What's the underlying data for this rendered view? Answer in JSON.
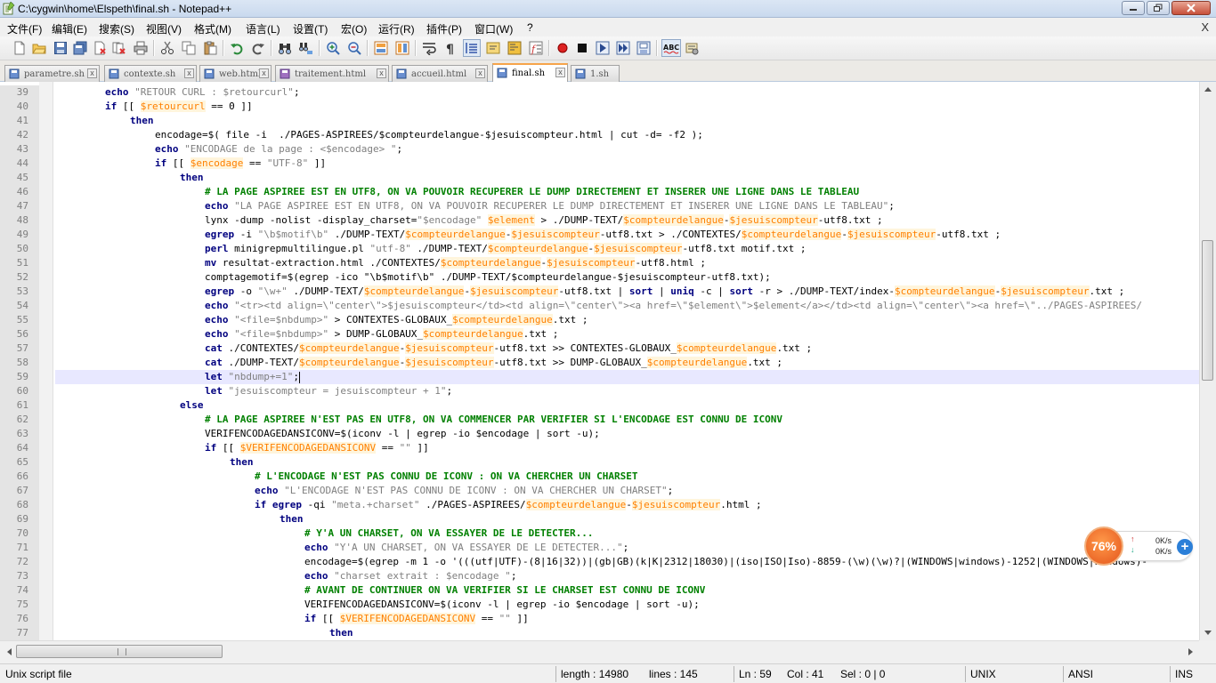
{
  "window": {
    "title": "C:\\cygwin\\home\\Elspeth\\final.sh - Notepad++"
  },
  "menu": {
    "items": [
      "文件(F)",
      "编辑(E)",
      "搜索(S)",
      "视图(V)",
      "格式(M)",
      "语言(L)",
      "设置(T)",
      "宏(O)",
      "运行(R)",
      "插件(P)",
      "窗口(W)",
      "?"
    ],
    "close_glyph": "X"
  },
  "toolbar": {
    "icons": [
      "new-file-icon",
      "open-file-icon",
      "save-icon",
      "save-all-icon",
      "close-icon",
      "close-all-icon",
      "print-icon",
      "cut-icon",
      "copy-icon",
      "paste-icon",
      "undo-icon",
      "redo-icon",
      "find-icon",
      "replace-icon",
      "zoom-in-icon",
      "zoom-out-icon",
      "sync-vertical-icon",
      "sync-horizontal-icon",
      "word-wrap-icon",
      "show-all-characters-icon",
      "indent-guide-icon",
      "user-language-icon",
      "doc-map-icon",
      "function-list-icon",
      "record-macro-icon",
      "stop-record-icon",
      "play-macro-icon",
      "run-macro-multiple-icon",
      "save-macro-icon",
      "spell-check-icon",
      "spell-check-options-icon"
    ],
    "spellcheck_label": "ABC"
  },
  "tabs": [
    {
      "label": "parametre.sh",
      "active": false
    },
    {
      "label": "contexte.sh",
      "active": false
    },
    {
      "label": "web.html",
      "active": false
    },
    {
      "label": "traitement.html",
      "active": false
    },
    {
      "label": "accueil.html",
      "active": false
    },
    {
      "label": "final.sh",
      "active": true
    },
    {
      "label": "1.sh",
      "active": false
    }
  ],
  "tab_close_glyph": "x",
  "editor": {
    "current_line": 59,
    "lines": [
      {
        "n": 39,
        "indent": 14,
        "tokens": [
          [
            "kw",
            "echo"
          ],
          [
            "st",
            " \"RETOUR CURL : $retourcurl\""
          ],
          [
            "",
            "; "
          ]
        ]
      },
      {
        "n": 40,
        "indent": 14,
        "tokens": [
          [
            "kw",
            "if"
          ],
          [
            "",
            " [[ "
          ],
          [
            "va",
            "$retourcurl"
          ],
          [
            "",
            " == 0 ]]"
          ]
        ]
      },
      {
        "n": 41,
        "indent": 21,
        "tokens": [
          [
            "kw",
            "then"
          ]
        ]
      },
      {
        "n": 42,
        "indent": 28,
        "tokens": [
          [
            "",
            "encodage=$( file -i  ./PAGES-ASPIREES/$compteurdelangue-$jesuiscompteur.html | cut -d= -f2 );"
          ]
        ]
      },
      {
        "n": 43,
        "indent": 28,
        "tokens": [
          [
            "kw",
            "echo"
          ],
          [
            "st",
            " \"ENCODAGE de la page : <$encodage> \""
          ],
          [
            "",
            ";"
          ]
        ]
      },
      {
        "n": 44,
        "indent": 28,
        "tokens": [
          [
            "kw",
            "if"
          ],
          [
            "",
            " [[ "
          ],
          [
            "va",
            "$encodage"
          ],
          [
            "",
            " == "
          ],
          [
            "st",
            "\"UTF-8\""
          ],
          [
            "",
            " ]]"
          ]
        ]
      },
      {
        "n": 45,
        "indent": 35,
        "tokens": [
          [
            "kw",
            "then"
          ]
        ]
      },
      {
        "n": 46,
        "indent": 42,
        "tokens": [
          [
            "cm",
            "# LA PAGE ASPIREE EST EN UTF8, ON VA POUVOIR RECUPERER LE DUMP DIRECTEMENT ET INSERER UNE LIGNE DANS LE TABLEAU"
          ]
        ]
      },
      {
        "n": 47,
        "indent": 42,
        "tokens": [
          [
            "kw",
            "echo"
          ],
          [
            "st",
            " \"LA PAGE ASPIREE EST EN UTF8, ON VA POUVOIR RECUPERER LE DUMP DIRECTEMENT ET INSERER UNE LIGNE DANS LE TABLEAU\""
          ],
          [
            "",
            ";"
          ]
        ]
      },
      {
        "n": 48,
        "indent": 42,
        "tokens": [
          [
            "",
            "lynx -dump -nolist -display_charset="
          ],
          [
            "st",
            "\"$encodage\""
          ],
          [
            "",
            " "
          ],
          [
            "va",
            "$element"
          ],
          [
            "",
            " > ./DUMP-TEXT/"
          ],
          [
            "va",
            "$compteurdelangue"
          ],
          [
            "",
            "-"
          ],
          [
            "va",
            "$jesuiscompteur"
          ],
          [
            "",
            "-utf8.txt ;"
          ]
        ]
      },
      {
        "n": 49,
        "indent": 42,
        "tokens": [
          [
            "kw",
            "egrep"
          ],
          [
            "",
            " -i "
          ],
          [
            "st",
            "\"\\b$motif\\b\""
          ],
          [
            "",
            " ./DUMP-TEXT/"
          ],
          [
            "va",
            "$compteurdelangue"
          ],
          [
            "",
            "-"
          ],
          [
            "va",
            "$jesuiscompteur"
          ],
          [
            "",
            "-utf8.txt > ./CONTEXTES/"
          ],
          [
            "va",
            "$compteurdelangue"
          ],
          [
            "",
            "-"
          ],
          [
            "va",
            "$jesuiscompteur"
          ],
          [
            "",
            "-utf8.txt ;"
          ]
        ]
      },
      {
        "n": 50,
        "indent": 42,
        "tokens": [
          [
            "kw",
            "perl"
          ],
          [
            "",
            " minigrepmultilingue.pl "
          ],
          [
            "st",
            "\"utf-8\""
          ],
          [
            "",
            " ./DUMP-TEXT/"
          ],
          [
            "va",
            "$compteurdelangue"
          ],
          [
            "",
            "-"
          ],
          [
            "va",
            "$jesuiscompteur"
          ],
          [
            "",
            "-utf8.txt motif.txt ;"
          ]
        ]
      },
      {
        "n": 51,
        "indent": 42,
        "tokens": [
          [
            "kw",
            "mv"
          ],
          [
            "",
            " resultat-extraction.html ./CONTEXTES/"
          ],
          [
            "va",
            "$compteurdelangue"
          ],
          [
            "",
            "-"
          ],
          [
            "va",
            "$jesuiscompteur"
          ],
          [
            "",
            "-utf8.html ;"
          ]
        ]
      },
      {
        "n": 52,
        "indent": 42,
        "tokens": [
          [
            "",
            "comptagemotif=$(egrep -ico \"\\b$motif\\b\" ./DUMP-TEXT/$compteurdelangue-$jesuiscompteur-utf8.txt);"
          ]
        ]
      },
      {
        "n": 53,
        "indent": 42,
        "tokens": [
          [
            "kw",
            "egrep"
          ],
          [
            "",
            " -o "
          ],
          [
            "st",
            "\"\\w+\""
          ],
          [
            "",
            " ./DUMP-TEXT/"
          ],
          [
            "va",
            "$compteurdelangue"
          ],
          [
            "",
            "-"
          ],
          [
            "va",
            "$jesuiscompteur"
          ],
          [
            "",
            "-utf8.txt | "
          ],
          [
            "kw",
            "sort"
          ],
          [
            "",
            " | "
          ],
          [
            "kw",
            "uniq"
          ],
          [
            "",
            " -c | "
          ],
          [
            "kw",
            "sort"
          ],
          [
            "",
            " -r > ./DUMP-TEXT/index-"
          ],
          [
            "va",
            "$compteurdelangue"
          ],
          [
            "",
            "-"
          ],
          [
            "va",
            "$jesuiscompteur"
          ],
          [
            "",
            ".txt ;"
          ]
        ]
      },
      {
        "n": 54,
        "indent": 42,
        "tokens": [
          [
            "kw",
            "echo"
          ],
          [
            "st",
            " \"<tr><td align=\\\"center\\\">$jesuiscompteur</td><td align=\\\"center\\\"><a href=\\\"$element\\\">$element</a></td><td align=\\\"center\\\"><a href=\\\"../PAGES-ASPIREES/"
          ]
        ]
      },
      {
        "n": 55,
        "indent": 42,
        "tokens": [
          [
            "kw",
            "echo"
          ],
          [
            "st",
            " \"<file=$nbdump>\""
          ],
          [
            "",
            " > CONTEXTES-GLOBAUX_"
          ],
          [
            "va",
            "$compteurdelangue"
          ],
          [
            "",
            ".txt ;"
          ]
        ]
      },
      {
        "n": 56,
        "indent": 42,
        "tokens": [
          [
            "kw",
            "echo"
          ],
          [
            "st",
            " \"<file=$nbdump>\""
          ],
          [
            "",
            " > DUMP-GLOBAUX_"
          ],
          [
            "va",
            "$compteurdelangue"
          ],
          [
            "",
            ".txt ;"
          ]
        ]
      },
      {
        "n": 57,
        "indent": 42,
        "tokens": [
          [
            "kw",
            "cat"
          ],
          [
            "",
            " ./CONTEXTES/"
          ],
          [
            "va",
            "$compteurdelangue"
          ],
          [
            "",
            "-"
          ],
          [
            "va",
            "$jesuiscompteur"
          ],
          [
            "",
            "-utf8.txt >> CONTEXTES-GLOBAUX_"
          ],
          [
            "va",
            "$compteurdelangue"
          ],
          [
            "",
            ".txt ;"
          ]
        ]
      },
      {
        "n": 58,
        "indent": 42,
        "tokens": [
          [
            "kw",
            "cat"
          ],
          [
            "",
            " ./DUMP-TEXT/"
          ],
          [
            "va",
            "$compteurdelangue"
          ],
          [
            "",
            "-"
          ],
          [
            "va",
            "$jesuiscompteur"
          ],
          [
            "",
            "-utf8.txt >> DUMP-GLOBAUX_"
          ],
          [
            "va",
            "$compteurdelangue"
          ],
          [
            "",
            ".txt ;"
          ]
        ]
      },
      {
        "n": 59,
        "indent": 42,
        "tokens": [
          [
            "kw",
            "let"
          ],
          [
            "st",
            " \"nbdump+=1\""
          ],
          [
            "",
            ";"
          ]
        ]
      },
      {
        "n": 60,
        "indent": 42,
        "tokens": [
          [
            "kw",
            "let"
          ],
          [
            "st",
            " \"jesuiscompteur = jesuiscompteur + 1\""
          ],
          [
            "",
            ";"
          ]
        ]
      },
      {
        "n": 61,
        "indent": 35,
        "tokens": [
          [
            "kw",
            "else"
          ]
        ]
      },
      {
        "n": 62,
        "indent": 42,
        "tokens": [
          [
            "cm",
            "# LA PAGE ASPIREE N'EST PAS EN UTF8, ON VA COMMENCER PAR VERIFIER SI L'ENCODAGE EST CONNU DE ICONV"
          ]
        ]
      },
      {
        "n": 63,
        "indent": 42,
        "tokens": [
          [
            "",
            "VERIFENCODAGEDANSICONV=$(iconv -l | egrep -io $encodage | sort -u);"
          ]
        ]
      },
      {
        "n": 64,
        "indent": 42,
        "tokens": [
          [
            "kw",
            "if"
          ],
          [
            "",
            " [[ "
          ],
          [
            "va",
            "$VERIFENCODAGEDANSICONV"
          ],
          [
            "",
            " == "
          ],
          [
            "st",
            "\"\""
          ],
          [
            "",
            " ]]"
          ]
        ]
      },
      {
        "n": 65,
        "indent": 49,
        "tokens": [
          [
            "kw",
            "then"
          ]
        ]
      },
      {
        "n": 66,
        "indent": 56,
        "tokens": [
          [
            "cm",
            "# L'ENCODAGE N'EST PAS CONNU DE ICONV : ON VA CHERCHER UN CHARSET"
          ]
        ]
      },
      {
        "n": 67,
        "indent": 56,
        "tokens": [
          [
            "kw",
            "echo"
          ],
          [
            "st",
            " \"L'ENCODAGE N'EST PAS CONNU DE ICONV : ON VA CHERCHER UN CHARSET\""
          ],
          [
            "",
            ";"
          ]
        ]
      },
      {
        "n": 68,
        "indent": 56,
        "tokens": [
          [
            "kw",
            "if"
          ],
          [
            "",
            " "
          ],
          [
            "kw",
            "egrep"
          ],
          [
            "",
            " -qi "
          ],
          [
            "st",
            "\"meta.+charset\""
          ],
          [
            "",
            " ./PAGES-ASPIREES/"
          ],
          [
            "va",
            "$compteurdelangue"
          ],
          [
            "",
            "-"
          ],
          [
            "va",
            "$jesuiscompteur"
          ],
          [
            "",
            ".html ;"
          ]
        ]
      },
      {
        "n": 69,
        "indent": 63,
        "tokens": [
          [
            "kw",
            "then"
          ]
        ]
      },
      {
        "n": 70,
        "indent": 70,
        "tokens": [
          [
            "cm",
            "# Y'A UN CHARSET, ON VA ESSAYER DE LE DETECTER..."
          ]
        ]
      },
      {
        "n": 71,
        "indent": 70,
        "tokens": [
          [
            "kw",
            "echo"
          ],
          [
            "st",
            " \"Y'A UN CHARSET, ON VA ESSAYER DE LE DETECTER...\""
          ],
          [
            "",
            ";"
          ]
        ]
      },
      {
        "n": 72,
        "indent": 70,
        "tokens": [
          [
            "",
            "encodage=$(egrep -m 1 -o '(((utf|UTF)-(8|16|32))|(gb|GB)(k|K|2312|18030)|(iso|ISO|Iso)-8859-(\\w)(\\w)?|(WINDOWS|windows)-1252|(WINDOWS|windows)-"
          ]
        ]
      },
      {
        "n": 73,
        "indent": 70,
        "tokens": [
          [
            "kw",
            "echo"
          ],
          [
            "st",
            " \"charset extrait : $encodage \""
          ],
          [
            "",
            ";"
          ]
        ]
      },
      {
        "n": 74,
        "indent": 70,
        "tokens": [
          [
            "cm",
            "# AVANT DE CONTINUER ON VA VERIFIER SI LE CHARSET EST CONNU DE ICONV"
          ]
        ]
      },
      {
        "n": 75,
        "indent": 70,
        "tokens": [
          [
            "",
            "VERIFENCODAGEDANSICONV=$(iconv -l | egrep -io $encodage | sort -u);"
          ]
        ]
      },
      {
        "n": 76,
        "indent": 70,
        "tokens": [
          [
            "kw",
            "if"
          ],
          [
            "",
            " [[ "
          ],
          [
            "va",
            "$VERIFENCODAGEDANSICONV"
          ],
          [
            "",
            " == "
          ],
          [
            "st",
            "\"\""
          ],
          [
            "",
            " ]]"
          ]
        ]
      },
      {
        "n": 77,
        "indent": 77,
        "tokens": [
          [
            "kw",
            "then"
          ]
        ]
      }
    ]
  },
  "status": {
    "file_type": "Unix script file",
    "length": "length : 14980",
    "lines": "lines : 145",
    "ln": "Ln : 59",
    "col": "Col : 41",
    "sel": "Sel : 0 | 0",
    "eol": "UNIX",
    "encoding": "ANSI",
    "ins": "INS"
  },
  "net_monitor": {
    "percent": "76%",
    "up_rate": "0K/s",
    "down_rate": "0K/s",
    "up_glyph": "↑",
    "down_glyph": "↓",
    "plus_glyph": "+"
  },
  "colors": {
    "comment": "#008000",
    "keyword": "#00007f",
    "string": "#7f7f7f",
    "variable": "#ff8000",
    "active_tab_accent": "#f6a44a",
    "current_line": "#e8e8ff"
  }
}
